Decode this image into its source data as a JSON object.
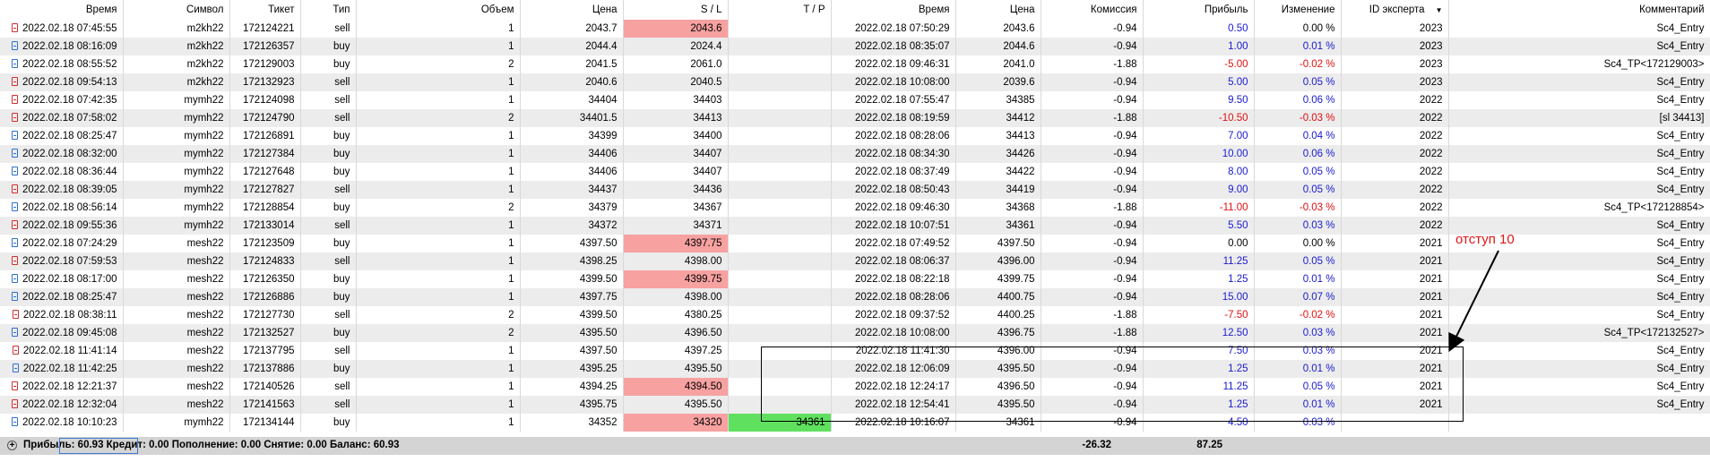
{
  "columns": {
    "time": "Время",
    "symbol": "Символ",
    "ticket": "Тикет",
    "type": "Тип",
    "volume": "Объем",
    "price": "Цена",
    "sl": "S / L",
    "tp": "T / P",
    "close_time": "Время",
    "close_price": "Цена",
    "commission": "Комиссия",
    "profit": "Прибыль",
    "change": "Изменение",
    "expert": "ID эксперта",
    "comment": "Комментарий"
  },
  "rows": [
    {
      "time": "2022.02.18 07:45:55",
      "symbol": "m2kh22",
      "ticket": "172124221",
      "type": "sell",
      "volume": "1",
      "price": "2043.7",
      "sl": "2043.6",
      "tp": "",
      "close_time": "2022.02.18 07:50:29",
      "close_price": "2043.6",
      "commission": "-0.94",
      "profit": "0.50",
      "change": "0.00 %",
      "expert": "2023",
      "comment": "Sc4_Entry"
    },
    {
      "time": "2022.02.18 08:16:09",
      "symbol": "m2kh22",
      "ticket": "172126357",
      "type": "buy",
      "volume": "1",
      "price": "2044.4",
      "sl": "2024.4",
      "tp": "",
      "close_time": "2022.02.18 08:35:07",
      "close_price": "2044.6",
      "commission": "-0.94",
      "profit": "1.00",
      "change": "0.01 %",
      "expert": "2023",
      "comment": "Sc4_Entry"
    },
    {
      "time": "2022.02.18 08:55:52",
      "symbol": "m2kh22",
      "ticket": "172129003",
      "type": "buy",
      "volume": "2",
      "price": "2041.5",
      "sl": "2061.0",
      "tp": "",
      "close_time": "2022.02.18 09:46:31",
      "close_price": "2041.0",
      "commission": "-1.88",
      "profit": "-5.00",
      "change": "-0.02 %",
      "expert": "2023",
      "comment": "Sc4_TP<172129003>"
    },
    {
      "time": "2022.02.18 09:54:13",
      "symbol": "m2kh22",
      "ticket": "172132923",
      "type": "sell",
      "volume": "1",
      "price": "2040.6",
      "sl": "2040.5",
      "tp": "",
      "close_time": "2022.02.18 10:08:00",
      "close_price": "2039.6",
      "commission": "-0.94",
      "profit": "5.00",
      "change": "0.05 %",
      "expert": "2023",
      "comment": "Sc4_Entry"
    },
    {
      "time": "2022.02.18 07:42:35",
      "symbol": "mymh22",
      "ticket": "172124098",
      "type": "sell",
      "volume": "1",
      "price": "34404",
      "sl": "34403",
      "tp": "",
      "close_time": "2022.02.18 07:55:47",
      "close_price": "34385",
      "commission": "-0.94",
      "profit": "9.50",
      "change": "0.06 %",
      "expert": "2022",
      "comment": "Sc4_Entry"
    },
    {
      "time": "2022.02.18 07:58:02",
      "symbol": "mymh22",
      "ticket": "172124790",
      "type": "sell",
      "volume": "2",
      "price": "34401.5",
      "sl": "34413",
      "tp": "",
      "close_time": "2022.02.18 08:19:59",
      "close_price": "34412",
      "commission": "-1.88",
      "profit": "-10.50",
      "change": "-0.03 %",
      "expert": "2022",
      "comment": "[sl 34413]"
    },
    {
      "time": "2022.02.18 08:25:47",
      "symbol": "mymh22",
      "ticket": "172126891",
      "type": "buy",
      "volume": "1",
      "price": "34399",
      "sl": "34400",
      "tp": "",
      "close_time": "2022.02.18 08:28:06",
      "close_price": "34413",
      "commission": "-0.94",
      "profit": "7.00",
      "change": "0.04 %",
      "expert": "2022",
      "comment": "Sc4_Entry"
    },
    {
      "time": "2022.02.18 08:32:00",
      "symbol": "mymh22",
      "ticket": "172127384",
      "type": "buy",
      "volume": "1",
      "price": "34406",
      "sl": "34407",
      "tp": "",
      "close_time": "2022.02.18 08:34:30",
      "close_price": "34426",
      "commission": "-0.94",
      "profit": "10.00",
      "change": "0.06 %",
      "expert": "2022",
      "comment": "Sc4_Entry"
    },
    {
      "time": "2022.02.18 08:36:44",
      "symbol": "mymh22",
      "ticket": "172127648",
      "type": "buy",
      "volume": "1",
      "price": "34406",
      "sl": "34407",
      "tp": "",
      "close_time": "2022.02.18 08:37:49",
      "close_price": "34422",
      "commission": "-0.94",
      "profit": "8.00",
      "change": "0.05 %",
      "expert": "2022",
      "comment": "Sc4_Entry"
    },
    {
      "time": "2022.02.18 08:39:05",
      "symbol": "mymh22",
      "ticket": "172127827",
      "type": "sell",
      "volume": "1",
      "price": "34437",
      "sl": "34436",
      "tp": "",
      "close_time": "2022.02.18 08:50:43",
      "close_price": "34419",
      "commission": "-0.94",
      "profit": "9.00",
      "change": "0.05 %",
      "expert": "2022",
      "comment": "Sc4_Entry"
    },
    {
      "time": "2022.02.18 08:56:14",
      "symbol": "mymh22",
      "ticket": "172128854",
      "type": "buy",
      "volume": "2",
      "price": "34379",
      "sl": "34367",
      "tp": "",
      "close_time": "2022.02.18 09:46:30",
      "close_price": "34368",
      "commission": "-1.88",
      "profit": "-11.00",
      "change": "-0.03 %",
      "expert": "2022",
      "comment": "Sc4_TP<172128854>"
    },
    {
      "time": "2022.02.18 09:55:36",
      "symbol": "mymh22",
      "ticket": "172133014",
      "type": "sell",
      "volume": "1",
      "price": "34372",
      "sl": "34371",
      "tp": "",
      "close_time": "2022.02.18 10:07:51",
      "close_price": "34361",
      "commission": "-0.94",
      "profit": "5.50",
      "change": "0.03 %",
      "expert": "2022",
      "comment": "Sc4_Entry"
    },
    {
      "time": "2022.02.18 07:24:29",
      "symbol": "mesh22",
      "ticket": "172123509",
      "type": "buy",
      "volume": "1",
      "price": "4397.50",
      "sl": "4397.75",
      "tp": "",
      "close_time": "2022.02.18 07:49:52",
      "close_price": "4397.50",
      "commission": "-0.94",
      "profit": "0.00",
      "change": "0.00 %",
      "expert": "2021",
      "comment": "Sc4_Entry"
    },
    {
      "time": "2022.02.18 07:59:53",
      "symbol": "mesh22",
      "ticket": "172124833",
      "type": "sell",
      "volume": "1",
      "price": "4398.25",
      "sl": "4398.00",
      "tp": "",
      "close_time": "2022.02.18 08:06:37",
      "close_price": "4396.00",
      "commission": "-0.94",
      "profit": "11.25",
      "change": "0.05 %",
      "expert": "2021",
      "comment": "Sc4_Entry"
    },
    {
      "time": "2022.02.18 08:17:00",
      "symbol": "mesh22",
      "ticket": "172126350",
      "type": "buy",
      "volume": "1",
      "price": "4399.50",
      "sl": "4399.75",
      "tp": "",
      "close_time": "2022.02.18 08:22:18",
      "close_price": "4399.75",
      "commission": "-0.94",
      "profit": "1.25",
      "change": "0.01 %",
      "expert": "2021",
      "comment": "Sc4_Entry"
    },
    {
      "time": "2022.02.18 08:25:47",
      "symbol": "mesh22",
      "ticket": "172126886",
      "type": "buy",
      "volume": "1",
      "price": "4397.75",
      "sl": "4398.00",
      "tp": "",
      "close_time": "2022.02.18 08:28:06",
      "close_price": "4400.75",
      "commission": "-0.94",
      "profit": "15.00",
      "change": "0.07 %",
      "expert": "2021",
      "comment": "Sc4_Entry"
    },
    {
      "time": "2022.02.18 08:38:11",
      "symbol": "mesh22",
      "ticket": "172127730",
      "type": "sell",
      "volume": "2",
      "price": "4399.50",
      "sl": "4380.25",
      "tp": "",
      "close_time": "2022.02.18 09:37:52",
      "close_price": "4400.25",
      "commission": "-1.88",
      "profit": "-7.50",
      "change": "-0.02 %",
      "expert": "2021",
      "comment": "Sc4_Entry"
    },
    {
      "time": "2022.02.18 09:45:08",
      "symbol": "mesh22",
      "ticket": "172132527",
      "type": "buy",
      "volume": "2",
      "price": "4395.50",
      "sl": "4396.50",
      "tp": "",
      "close_time": "2022.02.18 10:08:00",
      "close_price": "4396.75",
      "commission": "-1.88",
      "profit": "12.50",
      "change": "0.03 %",
      "expert": "2021",
      "comment": "Sc4_TP<172132527>"
    },
    {
      "time": "2022.02.18 11:41:14",
      "symbol": "mesh22",
      "ticket": "172137795",
      "type": "sell",
      "volume": "1",
      "price": "4397.50",
      "sl": "4397.25",
      "tp": "",
      "close_time": "2022.02.18 11:41:30",
      "close_price": "4396.00",
      "commission": "-0.94",
      "profit": "7.50",
      "change": "0.03 %",
      "expert": "2021",
      "comment": "Sc4_Entry"
    },
    {
      "time": "2022.02.18 11:42:25",
      "symbol": "mesh22",
      "ticket": "172137886",
      "type": "buy",
      "volume": "1",
      "price": "4395.25",
      "sl": "4395.50",
      "tp": "",
      "close_time": "2022.02.18 12:06:09",
      "close_price": "4395.50",
      "commission": "-0.94",
      "profit": "1.25",
      "change": "0.01 %",
      "expert": "2021",
      "comment": "Sc4_Entry"
    },
    {
      "time": "2022.02.18 12:21:37",
      "symbol": "mesh22",
      "ticket": "172140526",
      "type": "sell",
      "volume": "1",
      "price": "4394.25",
      "sl": "4394.50",
      "tp": "",
      "close_time": "2022.02.18 12:24:17",
      "close_price": "4396.50",
      "commission": "-0.94",
      "profit": "11.25",
      "change": "0.05 %",
      "expert": "2021",
      "comment": "Sc4_Entry"
    },
    {
      "time": "2022.02.18 12:32:04",
      "symbol": "mesh22",
      "ticket": "172141563",
      "type": "sell",
      "volume": "1",
      "price": "4395.75",
      "sl": "4395.50",
      "tp": "",
      "close_time": "2022.02.18 12:54:41",
      "close_price": "4395.50",
      "commission": "-0.94",
      "profit": "1.25",
      "change": "0.01 %",
      "expert": "2021",
      "comment": "Sc4_Entry"
    },
    {
      "time": "2022.02.18 10:10:23",
      "symbol": "mymh22",
      "ticket": "172134144",
      "type": "buy",
      "volume": "1",
      "price": "34352",
      "sl": "34320",
      "tp": "34361",
      "close_time": "2022.02.18 10:16:07",
      "close_price": "34361",
      "commission": "-0.94",
      "profit": "4.50",
      "change": "0.03 %",
      "expert": "",
      "comment": ""
    }
  ],
  "highlights": {
    "sl_red_rows": [
      0,
      12,
      14,
      20,
      22
    ],
    "tp_green_rows": [
      22
    ]
  },
  "footer": {
    "summary": "Прибыль: 60.93  Кредит: 0.00  Пополнение: 0.00  Снятие: 0.00  Баланс: 60.93",
    "commission_total": "-26.32",
    "profit_total": "87.25"
  },
  "annotation": {
    "text": "отступ 10"
  },
  "colors": {
    "sell_icon": "#d03030",
    "buy_icon": "#2f6fd0",
    "sl_highlight": "#f7a1a1",
    "tp_highlight": "#5fe05f",
    "profit_positive": "#1a1ad0",
    "profit_negative": "#e01010",
    "annotation": "#e01515"
  }
}
